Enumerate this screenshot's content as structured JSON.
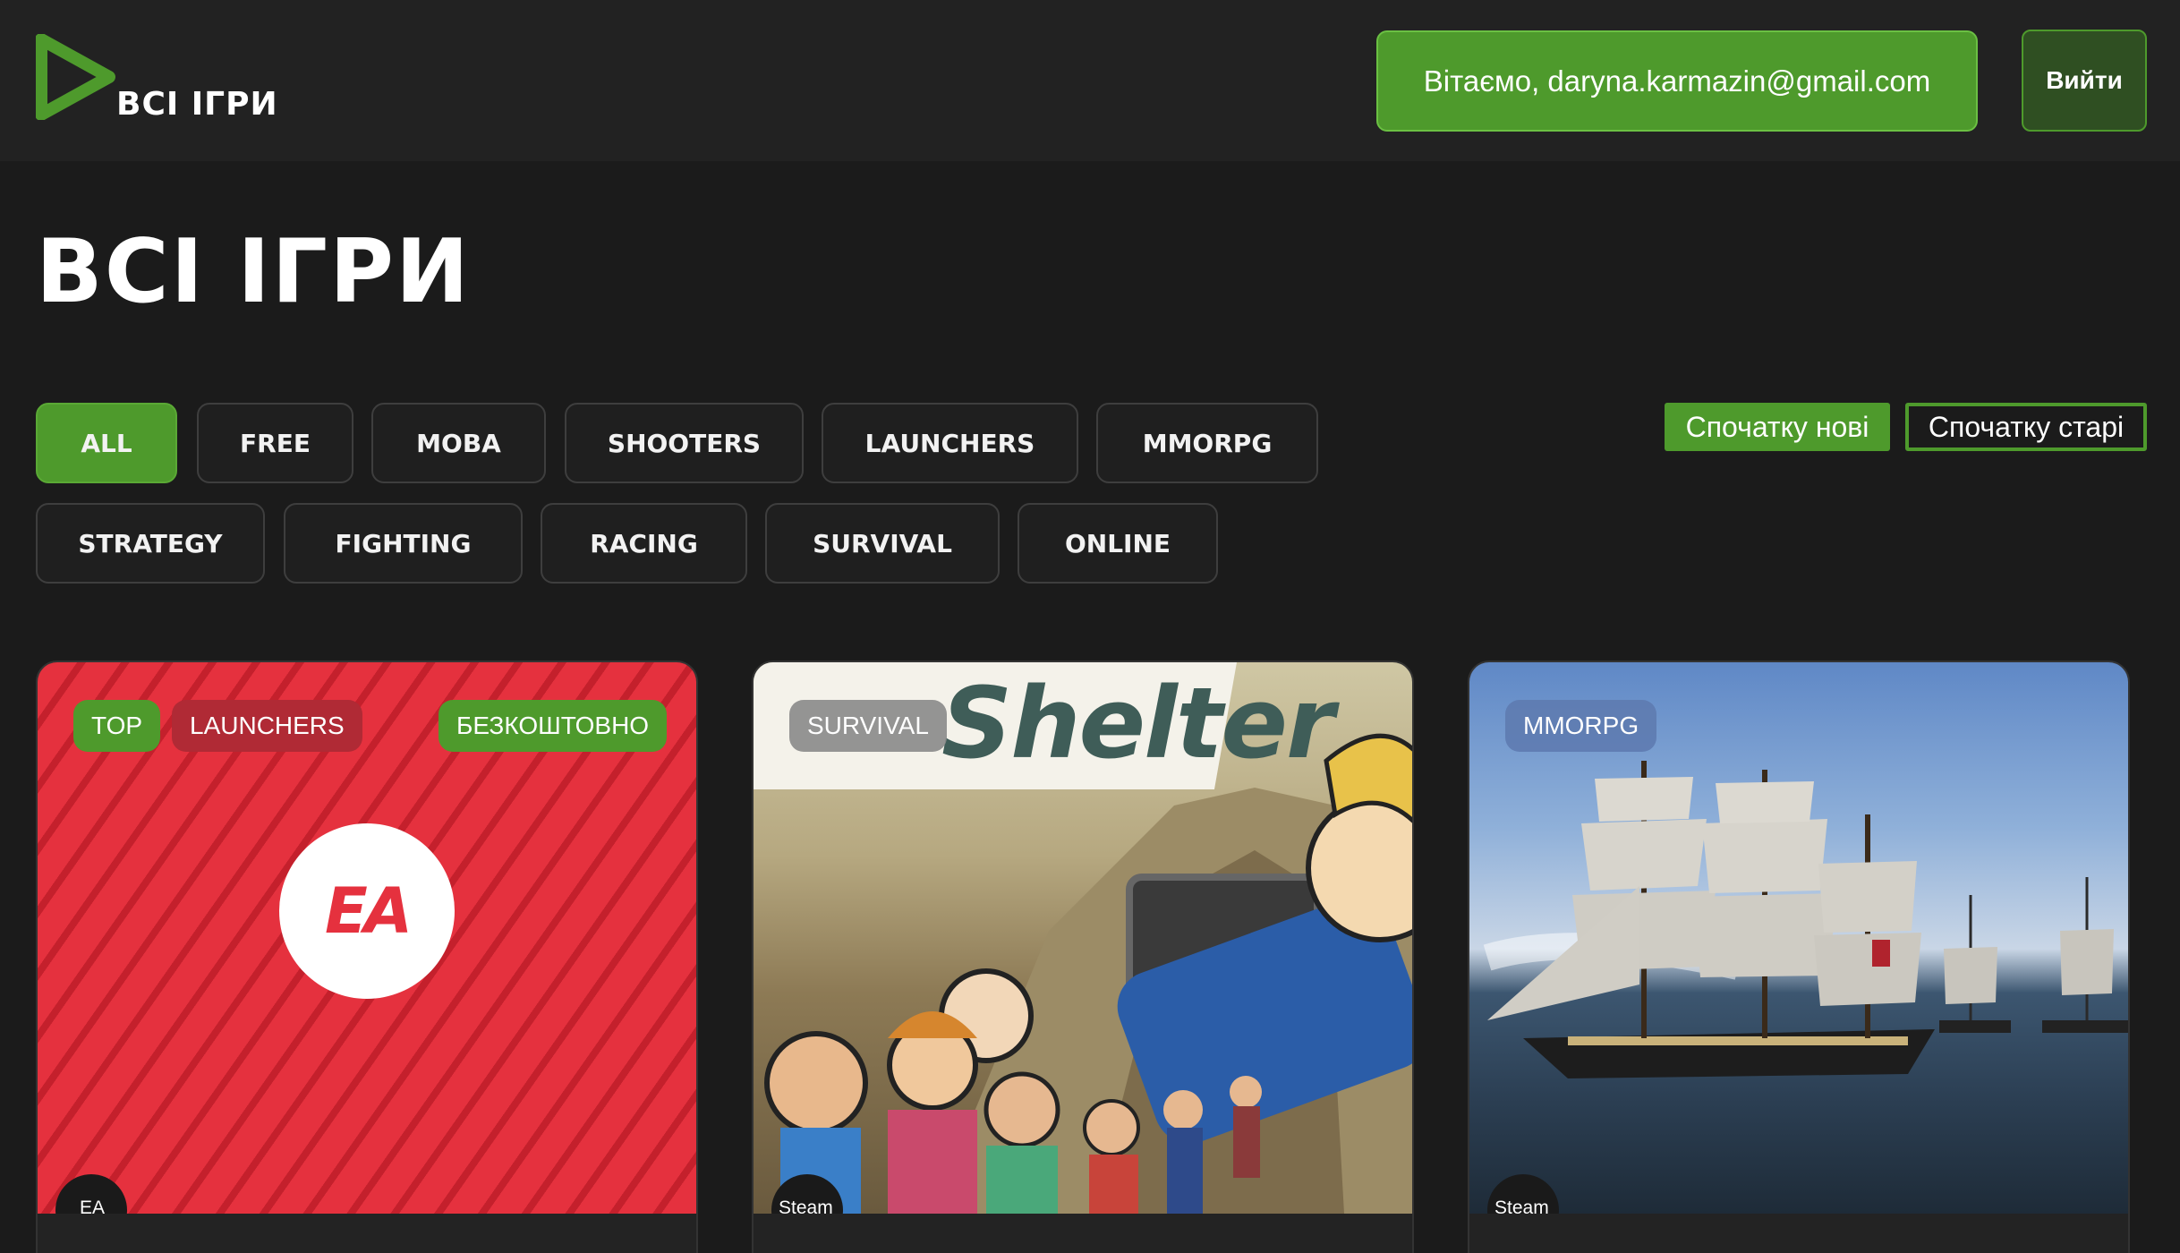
{
  "header": {
    "logo_text": "ВСІ ІГРИ",
    "greeting": "Вітаємо, daryna.karmazin@gmail.com",
    "logout_label": "Вийти"
  },
  "page": {
    "title": "ВСІ ІГРИ"
  },
  "filters": [
    {
      "label": "ALL",
      "active": true
    },
    {
      "label": "FREE",
      "active": false
    },
    {
      "label": "MOBA",
      "active": false
    },
    {
      "label": "SHOOTERS",
      "active": false
    },
    {
      "label": "LAUNCHERS",
      "active": false
    },
    {
      "label": "MMORPG",
      "active": false
    },
    {
      "label": "STRATEGY",
      "active": false
    },
    {
      "label": "FIGHTING",
      "active": false
    },
    {
      "label": "RACING",
      "active": false
    },
    {
      "label": "SURVIVAL",
      "active": false
    },
    {
      "label": "ONLINE",
      "active": false
    }
  ],
  "sort": {
    "newest_label": "Спочатку нові",
    "oldest_label": "Спочатку старі"
  },
  "cards": [
    {
      "tags": [
        "TOP",
        "LAUNCHERS",
        "БЕЗКОШТОВНО"
      ],
      "logo_text": "EA",
      "store": "EA"
    },
    {
      "tags": [
        "SURVIVAL"
      ],
      "image_text": "Shelter",
      "store": "Steam"
    },
    {
      "tags": [
        "MMORPG"
      ],
      "store": "Steam"
    }
  ],
  "colors": {
    "accent": "#4e9a2c",
    "background": "#1b1b1b",
    "header": "#222222",
    "top_tag": "#4e9a2c",
    "launchers_tag": "#b02a35",
    "free_tag": "#4e9a2c",
    "survival_tag": "#8a8a8a",
    "mmorpg_tag": "#5e7bb0"
  }
}
